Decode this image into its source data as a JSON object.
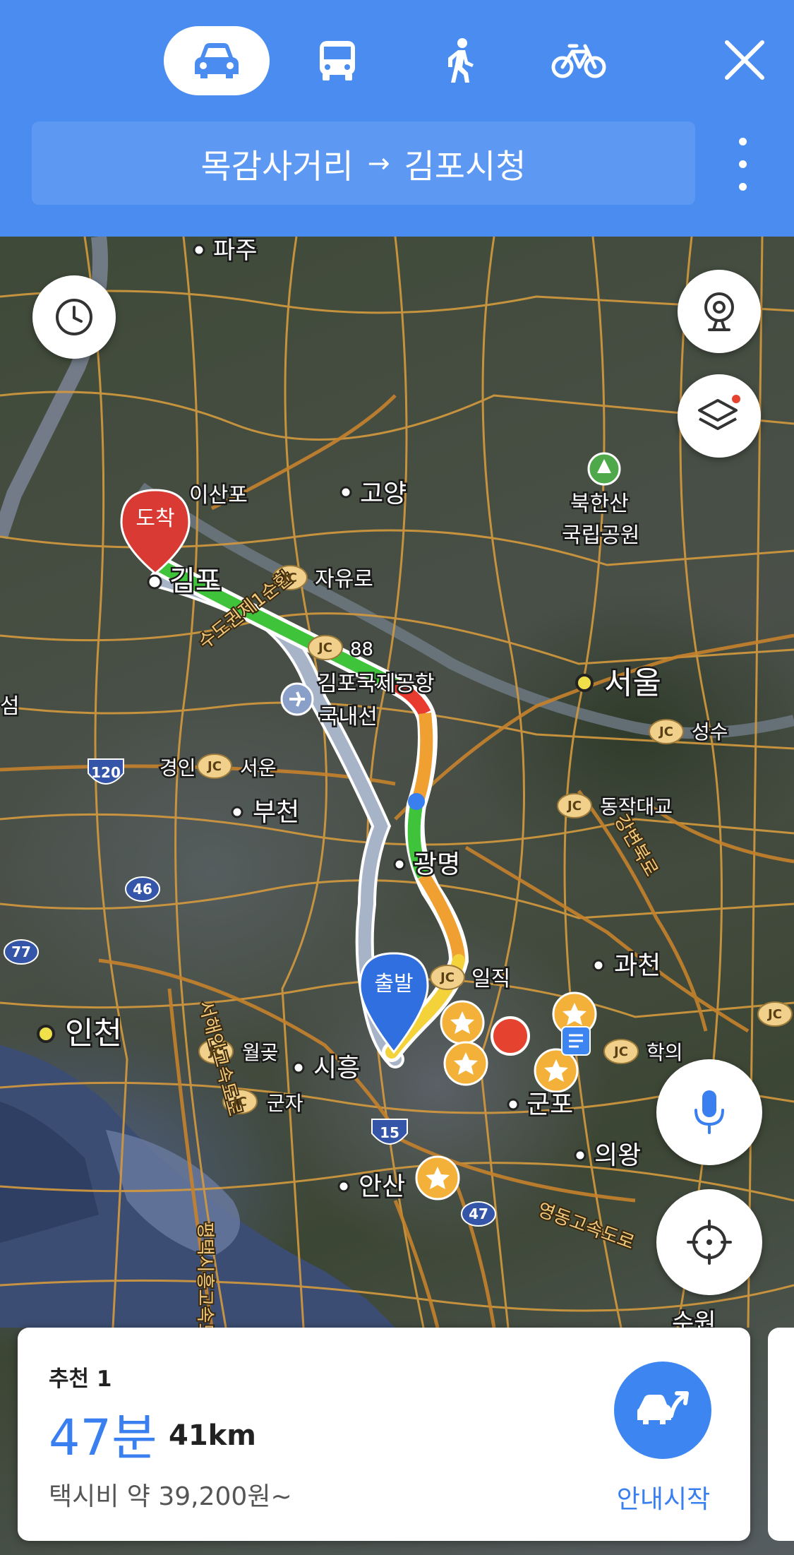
{
  "header": {
    "modes": [
      {
        "name": "car",
        "icon": "car-icon",
        "active": true
      },
      {
        "name": "bus",
        "icon": "bus-icon",
        "active": false
      },
      {
        "name": "walk",
        "icon": "walk-icon",
        "active": false
      },
      {
        "name": "bike",
        "icon": "bike-icon",
        "active": false
      }
    ],
    "origin": "목감사거리",
    "arrow": "→",
    "destination": "김포시청"
  },
  "map": {
    "labels": {
      "paju": "파주",
      "isanpo": "이산포",
      "goyang": "고양",
      "bukhansan1": "북한산",
      "bukhansan2": "국립공원",
      "gimpo": "김포",
      "jayuro": "자유로",
      "route88": "88",
      "airport1": "김포국제공항",
      "airport2": "국내선",
      "seoul": "서울",
      "seongsu": "성수",
      "route120": "120",
      "gyeongin": "경인",
      "seoun": "서운",
      "bucheon": "부천",
      "dongjak": "동작대교",
      "gwangmyeong": "광명",
      "route46": "46",
      "route77": "77",
      "iljik": "일직",
      "gwacheon": "과천",
      "incheon": "인천",
      "wolgot": "월곶",
      "siheung": "시흥",
      "hakui": "학의",
      "gunja": "군자",
      "gunpo": "군포",
      "route15": "15",
      "uiwang": "의왕",
      "ansan": "안산",
      "route47": "47",
      "suwon": "수원",
      "seom": "섬",
      "jc": "JC",
      "yeongdong_expwy": "영동고속도로",
      "sudogwon_ring": "수도권제1순환",
      "pyeongtaek_siheung": "평택시흥고속도로",
      "gangbyeon": "강변북로",
      "seohaean": "서해안고속도로"
    },
    "pins": {
      "arrival": "도착",
      "departure": "출발"
    },
    "route_colors": {
      "recommended": "#3ec33a",
      "slow": "#f0a030",
      "jam": "#e83a2e",
      "moderate": "#f4d23a",
      "alternative": "#a7b4c8"
    }
  },
  "controls": {
    "history": "clock-icon",
    "cctv": "cctv-icon",
    "layers": "layers-icon",
    "voice": "microphone-icon",
    "locate": "crosshair-icon"
  },
  "route_card": {
    "label": "추천 1",
    "duration": "47분",
    "distance": "41km",
    "fare": "택시비 약 39,200원~",
    "start_button": "안내시작"
  }
}
